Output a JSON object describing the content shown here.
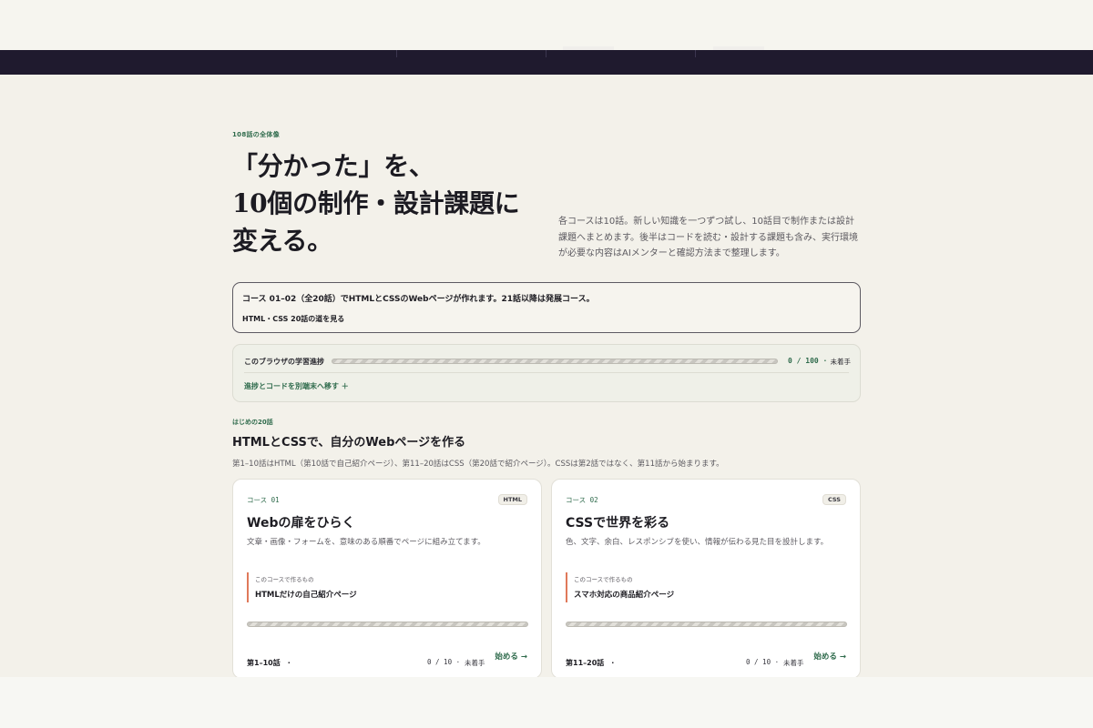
{
  "hero": {
    "eyebrow": "108話の全体像",
    "title_line1": "「分かった」を、",
    "title_line2": "10個の制作・設計課題に",
    "title_line3": "変える。",
    "description": "各コースは10話。新しい知識を一つずつ試し、10話目で制作または設計課題へまとめます。後半はコードを読む・設計する課題も含み、実行環境が必要な内容はAIメンターと確認方法まで整理します。"
  },
  "callout": {
    "text": "コース 01–02（全20話）でHTMLとCSSのWebページが作れます。21話以降は発展コース。",
    "link": "HTML・CSS 20話の道を見る"
  },
  "progress": {
    "label": "このブラウザの学習進捗",
    "count": "0 / 100 ·",
    "status": "未着手",
    "fraction": 0,
    "sync_link": "進捗とコードを別端末へ移す ＋"
  },
  "section": {
    "eyebrow": "はじめの20話",
    "title": "HTMLとCSSで、自分のWebページを作る",
    "description": "第1–10話はHTML（第10話で自己紹介ページ）、第11–20話はCSS（第20話で紹介ページ）。CSSは第2話ではなく、第11話から始まります。"
  },
  "cards": [
    {
      "course_no": "コース 01",
      "tag": "HTML",
      "title": "Webの扉をひらく",
      "description": "文章・画像・フォームを、意味のある順番でページに組み立てます。",
      "make_label": "このコースで作るもの",
      "make_value": "HTMLだけの自己紹介ページ",
      "progress_fraction": 0,
      "range": "第1–10話　·",
      "count": "0 / 10 ·",
      "status": "未着手",
      "start": "始める →"
    },
    {
      "course_no": "コース 02",
      "tag": "CSS",
      "title": "CSSで世界を彩る",
      "description": "色、文字、余白、レスポンシブを使い、情報が伝わる見た目を設計します。",
      "make_label": "このコースで作るもの",
      "make_value": "スマホ対応の商品紹介ページ",
      "progress_fraction": 0,
      "range": "第11–20話　·",
      "count": "0 / 10 ·",
      "status": "未着手",
      "start": "始める →"
    }
  ],
  "colors": {
    "accent": "#2f6b4c",
    "nav_bg": "#1f1a2e",
    "page_bg": "#f3f1ea",
    "marker": "#e0795a"
  }
}
